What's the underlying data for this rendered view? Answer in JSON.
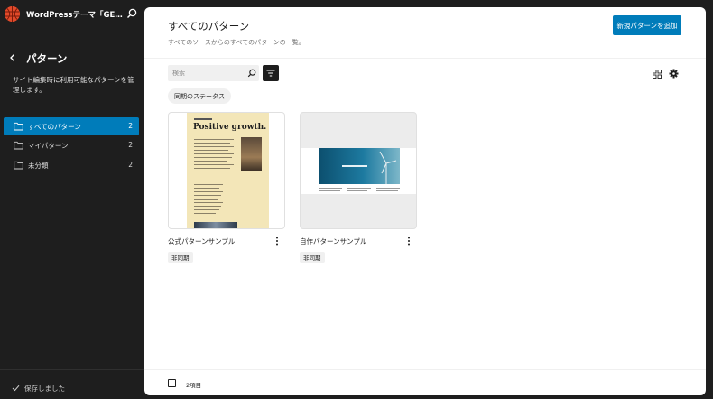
{
  "site": {
    "title": "WordPressテーマ「GE…"
  },
  "sidebar": {
    "title": "パターン",
    "description": "サイト編集時に利用可能なパターンを管理します。",
    "items": [
      {
        "label": "すべてのパターン",
        "count": "2",
        "active": true
      },
      {
        "label": "マイパターン",
        "count": "2",
        "active": false
      },
      {
        "label": "未分類",
        "count": "2",
        "active": false
      }
    ],
    "footer_status": "保存しました"
  },
  "main": {
    "title": "すべてのパターン",
    "description": "すべてのソースからのすべてのパターンの一覧。",
    "add_button": "新規パターンを追加",
    "search_placeholder": "検索",
    "filter_chip": "同期のステータス",
    "cards": [
      {
        "title": "公式パターンサンプル",
        "badge": "非同期",
        "preview_headline": "Positive growth."
      },
      {
        "title": "自作パターンサンプル",
        "badge": "非同期"
      }
    ],
    "item_count": "2項目"
  },
  "colors": {
    "accent": "#007cba",
    "sidebar_bg": "#1e1e1e",
    "logo": "#e24a2a"
  },
  "icons": [
    "wordpress-globe-icon",
    "search-icon",
    "chevron-left-icon",
    "folder-icon",
    "check-icon",
    "filter-icon",
    "grid-view-icon",
    "gear-icon",
    "more-vertical-icon"
  ]
}
